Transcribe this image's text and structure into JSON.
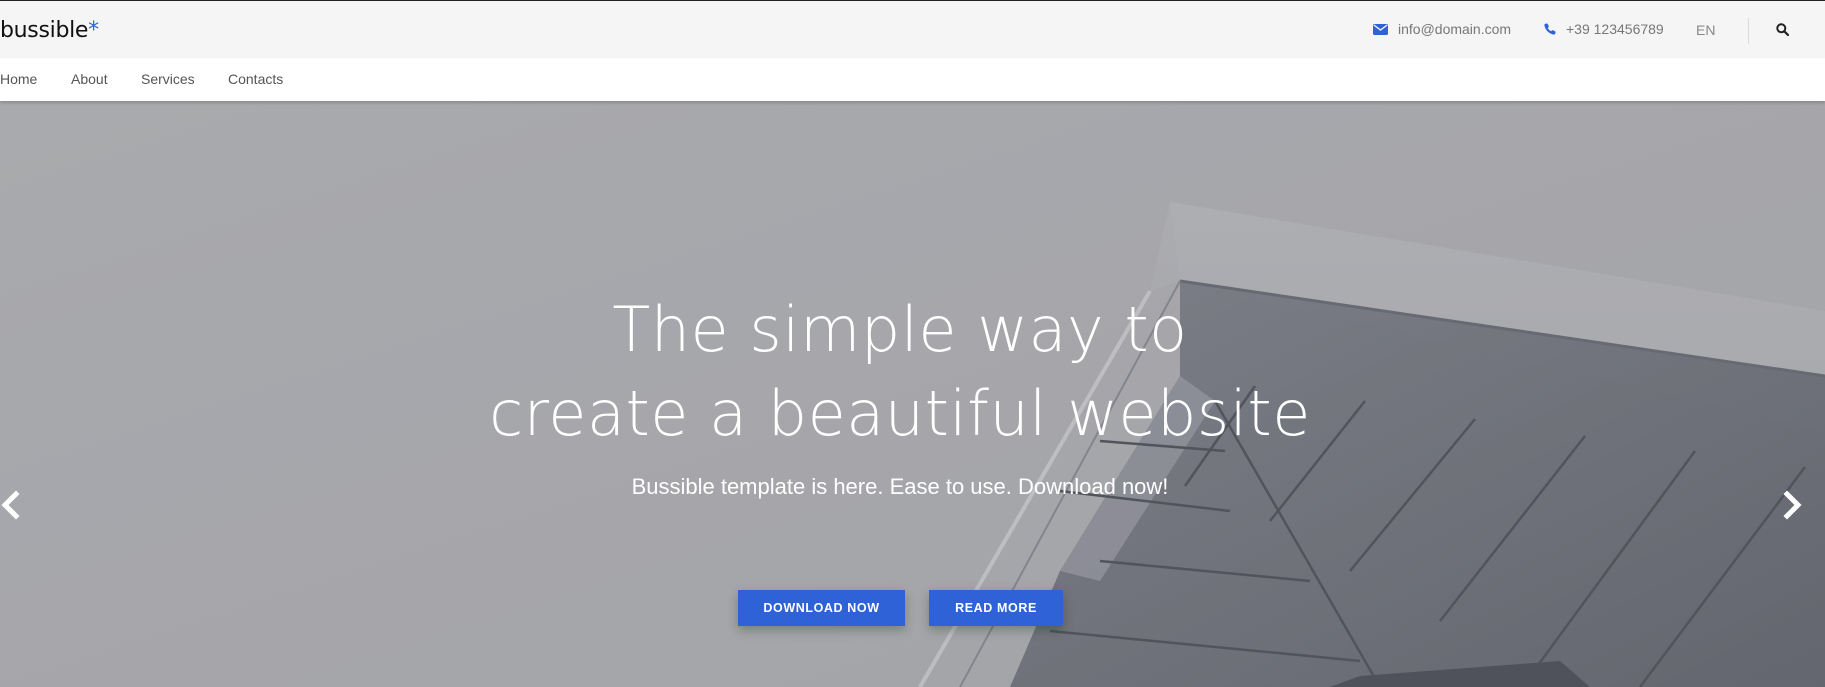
{
  "brand": {
    "name": "bussible",
    "mark": "*"
  },
  "topbar": {
    "email": "info@domain.com",
    "phone": "+39 123456789",
    "language": "EN"
  },
  "nav": {
    "items": [
      {
        "label": "Home"
      },
      {
        "label": "About"
      },
      {
        "label": "Services"
      },
      {
        "label": "Contacts"
      }
    ]
  },
  "hero": {
    "headline_line1": "The simple way to",
    "headline_line2": "create a beautiful website",
    "subline": "Bussible template is here. Ease to use. Download now!",
    "primary_button": "DOWNLOAD NOW",
    "secondary_button": "READ MORE"
  },
  "icons": {
    "email": "envelope-icon",
    "phone": "phone-icon",
    "search": "search-icon",
    "prev": "chevron-left-icon",
    "next": "chevron-right-icon"
  },
  "colors": {
    "accent": "#2f62d6",
    "topbar_bg": "#f5f5f5",
    "hero_overlay": "#a7a8ab"
  }
}
